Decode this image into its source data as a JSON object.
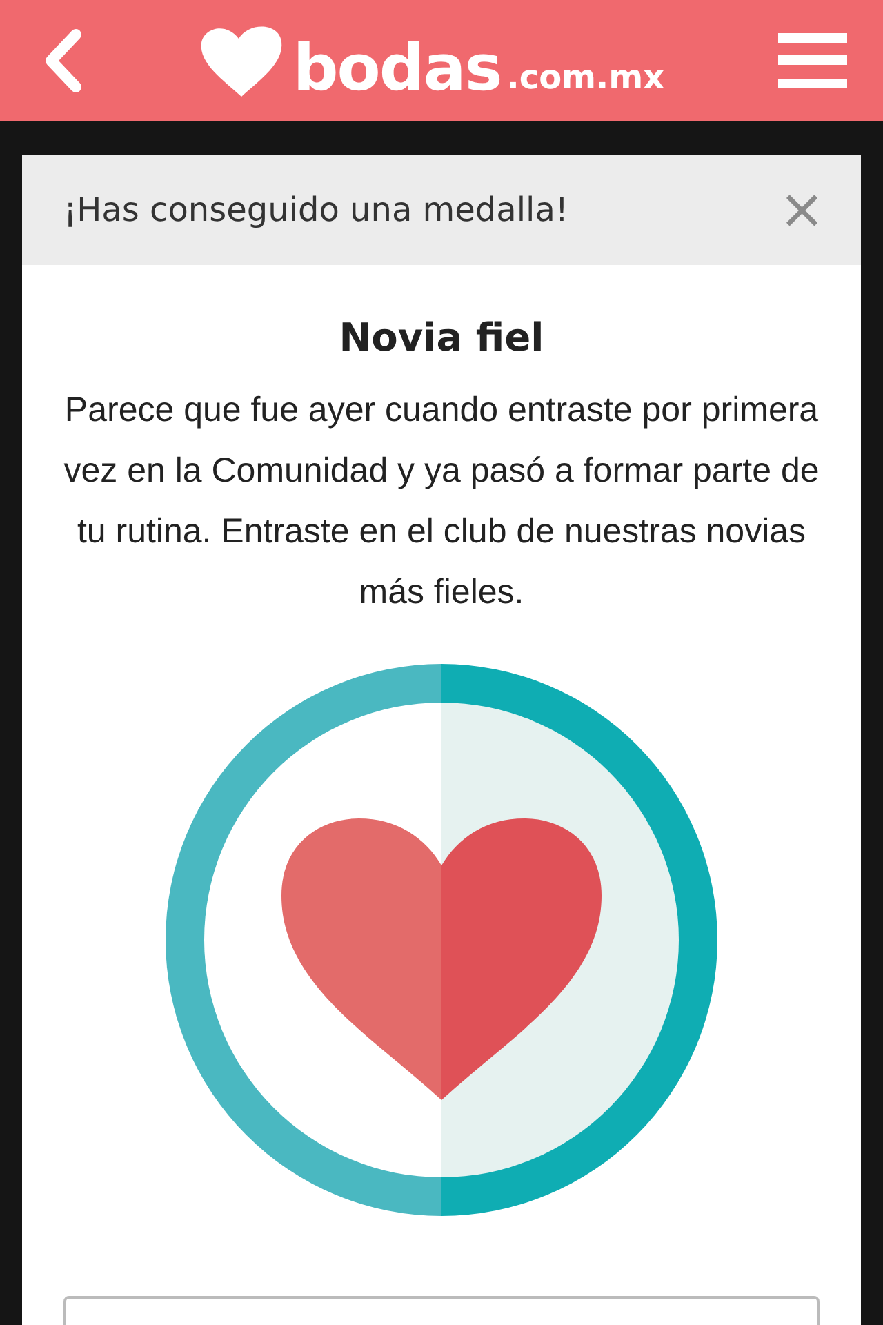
{
  "header": {
    "logo_text": "bodas",
    "logo_suffix": ".com.mx"
  },
  "modal": {
    "title": "¡Has conseguido una medalla!",
    "close": "×",
    "medal_name": "Novia fiel",
    "description": "Parece que fue ayer cuando entraste por primera vez en la Comunidad y ya pasó a formar parte de tu rutina. Entraste en el club de nuestras novias más fieles."
  }
}
